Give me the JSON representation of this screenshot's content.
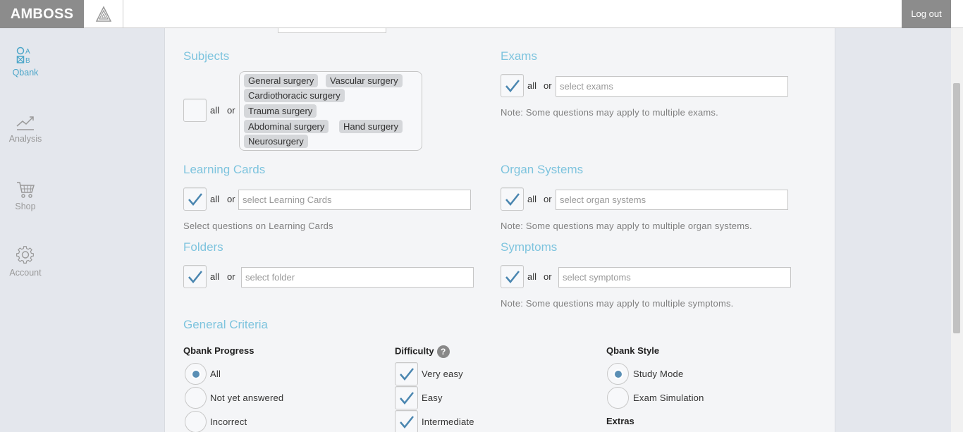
{
  "header": {
    "brand": "AMBOSS",
    "logout": "Log out"
  },
  "sidebar": {
    "items": [
      {
        "label": "Qbank",
        "icon": "qbank-icon",
        "active": true
      },
      {
        "label": "Analysis",
        "icon": "chart-icon"
      },
      {
        "label": "Shop",
        "icon": "cart-icon"
      },
      {
        "label": "Account",
        "icon": "gear-icon"
      }
    ]
  },
  "common": {
    "all": "all",
    "or": "or"
  },
  "subjects": {
    "title": "Subjects",
    "all_checked": false,
    "tags": [
      "General surgery",
      "Vascular surgery",
      "Cardiothoracic surgery",
      "Trauma surgery",
      "Abdominal surgery",
      "Hand surgery",
      "Neurosurgery"
    ]
  },
  "exams": {
    "title": "Exams",
    "all_checked": true,
    "placeholder": "select exams",
    "note": "Note: Some questions may apply to multiple exams."
  },
  "learning_cards": {
    "title": "Learning Cards",
    "all_checked": true,
    "placeholder": "select Learning Cards",
    "note": "Select questions on Learning Cards"
  },
  "organ_systems": {
    "title": "Organ Systems",
    "all_checked": true,
    "placeholder": "select organ systems",
    "note": "Note: Some questions may apply to multiple organ systems."
  },
  "folders": {
    "title": "Folders",
    "all_checked": true,
    "placeholder": "select folder"
  },
  "symptoms": {
    "title": "Symptoms",
    "all_checked": true,
    "placeholder": "select symptoms",
    "note": "Note: Some questions may apply to multiple symptoms."
  },
  "general_criteria": {
    "title": "General Criteria",
    "qbank_progress": {
      "heading": "Qbank Progress",
      "options": [
        {
          "label": "All",
          "selected": true
        },
        {
          "label": "Not yet answered",
          "selected": false
        },
        {
          "label": "Incorrect",
          "selected": false
        }
      ]
    },
    "difficulty": {
      "heading": "Difficulty",
      "help": "?",
      "options": [
        {
          "label": "Very easy",
          "checked": true
        },
        {
          "label": "Easy",
          "checked": true
        },
        {
          "label": "Intermediate",
          "checked": true
        }
      ]
    },
    "qbank_style": {
      "heading": "Qbank Style",
      "options": [
        {
          "label": "Study Mode",
          "selected": true
        },
        {
          "label": "Exam Simulation",
          "selected": false
        }
      ]
    },
    "extras": {
      "heading": "Extras"
    }
  },
  "colors": {
    "accent": "#7ec4de",
    "nav_active": "#4aa5c8",
    "check": "#4a86b0",
    "brand_bg": "#8c8c8c"
  }
}
